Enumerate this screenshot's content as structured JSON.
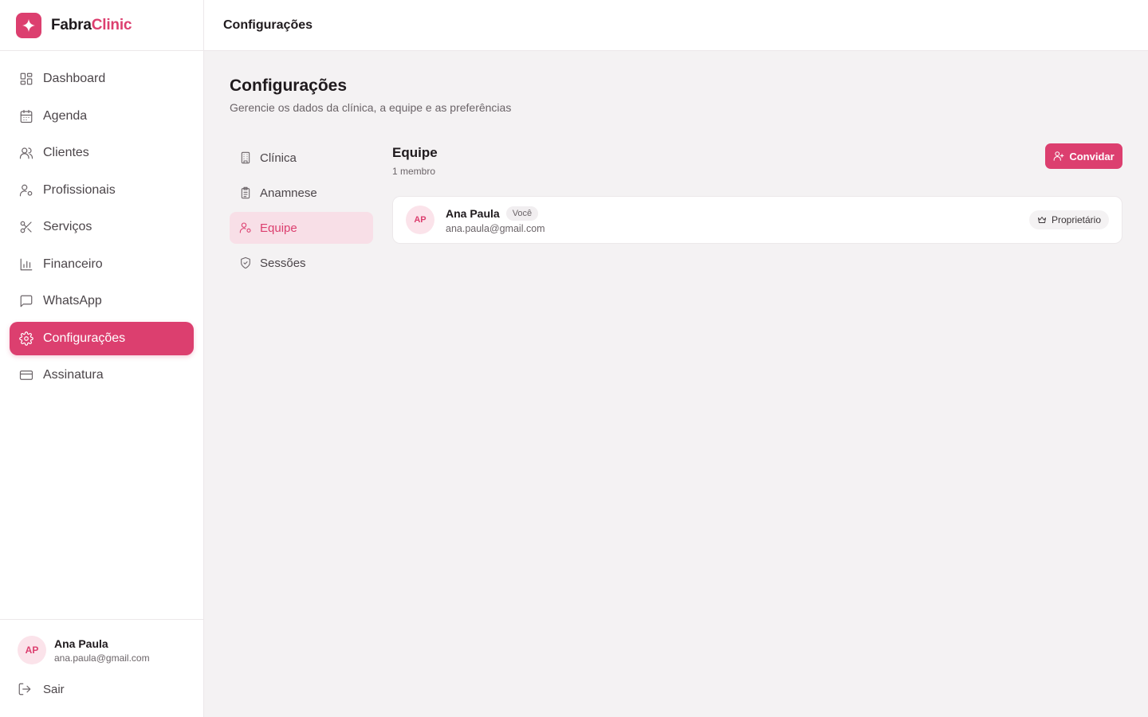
{
  "brand": {
    "name_part1": "Fabra",
    "name_part2": "Clinic",
    "accent": "#dc3f6f"
  },
  "sidebar": {
    "items": [
      {
        "label": "Dashboard",
        "icon": "dashboard-icon"
      },
      {
        "label": "Agenda",
        "icon": "calendar-icon"
      },
      {
        "label": "Clientes",
        "icon": "users-icon"
      },
      {
        "label": "Profissionais",
        "icon": "user-cog-icon"
      },
      {
        "label": "Serviços",
        "icon": "scissors-icon"
      },
      {
        "label": "Financeiro",
        "icon": "bar-chart-icon"
      },
      {
        "label": "WhatsApp",
        "icon": "message-icon"
      },
      {
        "label": "Configurações",
        "icon": "gear-icon",
        "active": true
      },
      {
        "label": "Assinatura",
        "icon": "credit-card-icon"
      }
    ],
    "user": {
      "initials": "AP",
      "name": "Ana Paula",
      "email": "ana.paula@gmail.com"
    },
    "logout_label": "Sair"
  },
  "topbar": {
    "title": "Configurações"
  },
  "page": {
    "title": "Configurações",
    "subtitle": "Gerencie os dados da clínica, a equipe e as preferências"
  },
  "settings_nav": {
    "items": [
      {
        "label": "Clínica",
        "icon": "building-icon"
      },
      {
        "label": "Anamnese",
        "icon": "clipboard-icon"
      },
      {
        "label": "Equipe",
        "icon": "user-cog-icon",
        "active": true
      },
      {
        "label": "Sessões",
        "icon": "shield-icon"
      }
    ]
  },
  "team": {
    "title": "Equipe",
    "count_label": "1 membro",
    "invite_label": "Convidar",
    "members": [
      {
        "initials": "AP",
        "name": "Ana Paula",
        "badge": "Você",
        "email": "ana.paula@gmail.com",
        "role": "Proprietário"
      }
    ]
  }
}
